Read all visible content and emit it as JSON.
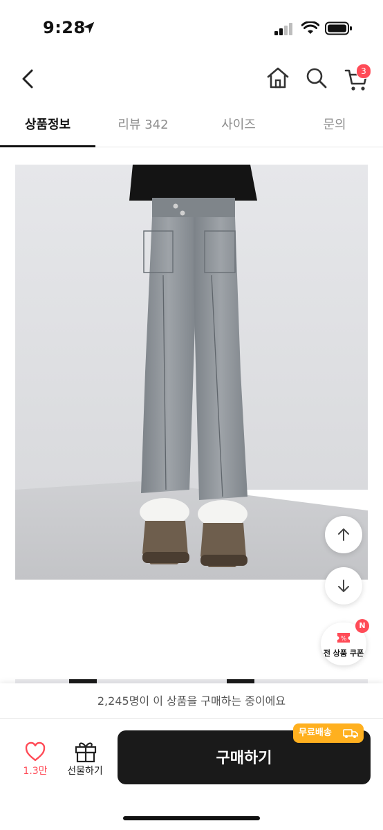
{
  "status_bar": {
    "time": "9:28",
    "icons": [
      "location-arrow-icon",
      "cellular-signal-icon",
      "wifi-icon",
      "battery-icon"
    ]
  },
  "header": {
    "back_icon": "chevron-left-icon",
    "home_icon": "home-icon",
    "search_icon": "search-icon",
    "cart_icon": "cart-icon",
    "cart_count": "3"
  },
  "tabs": [
    {
      "label": "상품정보",
      "active": true
    },
    {
      "label": "리뷰 342",
      "active": false
    },
    {
      "label": "사이즈",
      "active": false
    },
    {
      "label": "문의",
      "active": false
    }
  ],
  "floating": {
    "scroll_up_icon": "arrow-up-icon",
    "scroll_down_icon": "arrow-down-icon",
    "coupon_label": "전 상품 쿠폰",
    "coupon_badge": "N"
  },
  "bottom": {
    "purchase_info": "2,245명이 이 상품을 구매하는 중이에요",
    "like_count": "1.3만",
    "gift_label": "선물하기",
    "buy_label": "구매하기",
    "free_shipping_label": "무료배송"
  },
  "colors": {
    "accent_red": "#ff4b57",
    "buy_button": "#1a1a1a",
    "free_ship_badge": "#ffb01f"
  }
}
